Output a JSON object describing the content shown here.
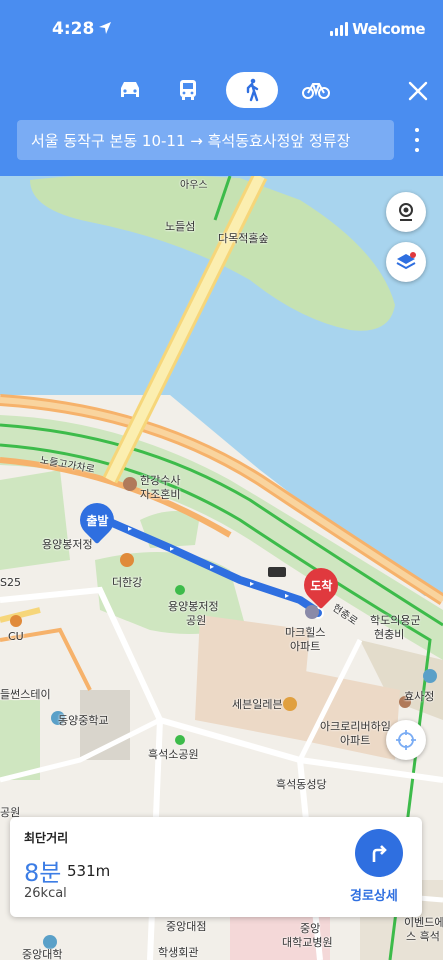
{
  "status_bar": {
    "time": "4:28",
    "carrier": "Welcome"
  },
  "header": {
    "modes": [
      {
        "name": "car",
        "icon": "car-icon",
        "active": false
      },
      {
        "name": "transit",
        "icon": "bus-icon",
        "active": false
      },
      {
        "name": "walk",
        "icon": "walk-icon",
        "active": true
      },
      {
        "name": "bike",
        "icon": "bike-icon",
        "active": false
      }
    ],
    "route_text": "서울 동작구 본동 10-11 → 흑석동효사정앞 정류장"
  },
  "map": {
    "labels": {
      "noduleseom": "노들섬",
      "arts": "아우스",
      "damokjeok": "다목적홀숲",
      "nodeul_gil": "노들고가차로",
      "hangang_suja": "한강수사",
      "jachonbi": "자조혼비",
      "yongyangbong": "용양봉저정",
      "deo_hangang": "더한강",
      "park1": "용양봉저정",
      "park2": "공원",
      "gs25": "S25",
      "cu": "CU",
      "seven": "들썬스테이",
      "markhills1": "마크힐스",
      "markhills2": "아파트",
      "hakdo1": "학도의용군",
      "hakdo2": "현충비",
      "hyosajeong": "효사정",
      "seven_eleven": "세븐일레븐",
      "acro1": "아크로리버하임",
      "acro2": "아파트",
      "dongyang": "동양중학교",
      "heukseok_park": "흑석소공원",
      "heukseok_church": "흑석동성당",
      "park_left": "공원",
      "junang_univ": "중앙대점",
      "student_hall": "학생회관",
      "hosp1": "중앙",
      "hosp2": "대학교병원",
      "ibd1": "이벤드에",
      "ibd2": "스 흑석",
      "road_left": "현충로",
      "univ_bottom": "중앙대학"
    },
    "pins": {
      "start": "출발",
      "end": "도착"
    }
  },
  "summary": {
    "label": "최단거리",
    "time": "8분",
    "distance": "531m",
    "calories": "26kcal",
    "detail_button": "경로상세"
  },
  "colors": {
    "header": "#4a8df0",
    "route": "#2f6fe0",
    "start_pin": "#2f6fe0",
    "end_pin": "#e0393e",
    "water": "#a8d4ee"
  }
}
